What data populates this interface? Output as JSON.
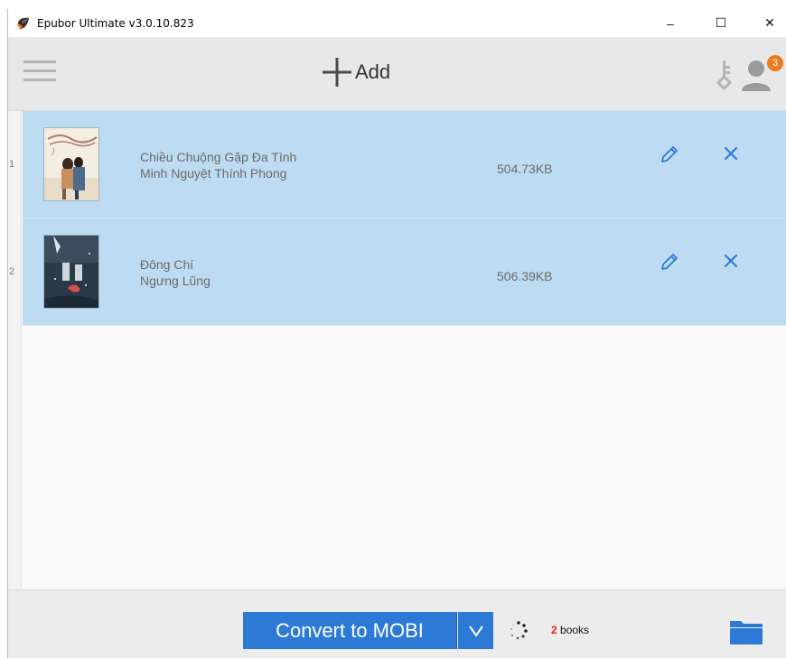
{
  "window": {
    "title": "Epubor Ultimate v3.0.10.823",
    "controls": {
      "minimize": "–",
      "maximize": "☐",
      "close": "✕"
    }
  },
  "toolbar": {
    "add_label": "Add",
    "icons": [
      "menu-icon",
      "plus-icon",
      "key-icon",
      "user-icon"
    ],
    "notification_count": "3"
  },
  "books": [
    {
      "index": "1",
      "title": "Chiều Chuộng Gặp Đa Tình",
      "author": "Minh Nguyệt Thính Phong",
      "size": "504.73KB"
    },
    {
      "index": "2",
      "title": "Đông Chí",
      "author": "Ngưng Lũng",
      "size": "506.39KB"
    }
  ],
  "footer": {
    "convert_label": "Convert to MOBI",
    "count_number": "2",
    "count_label": " books"
  },
  "colors": {
    "accent": "#2d7ad6",
    "row_selected": "#bedcf1",
    "badge": "#f07a1f",
    "count_number": "#e02020"
  }
}
